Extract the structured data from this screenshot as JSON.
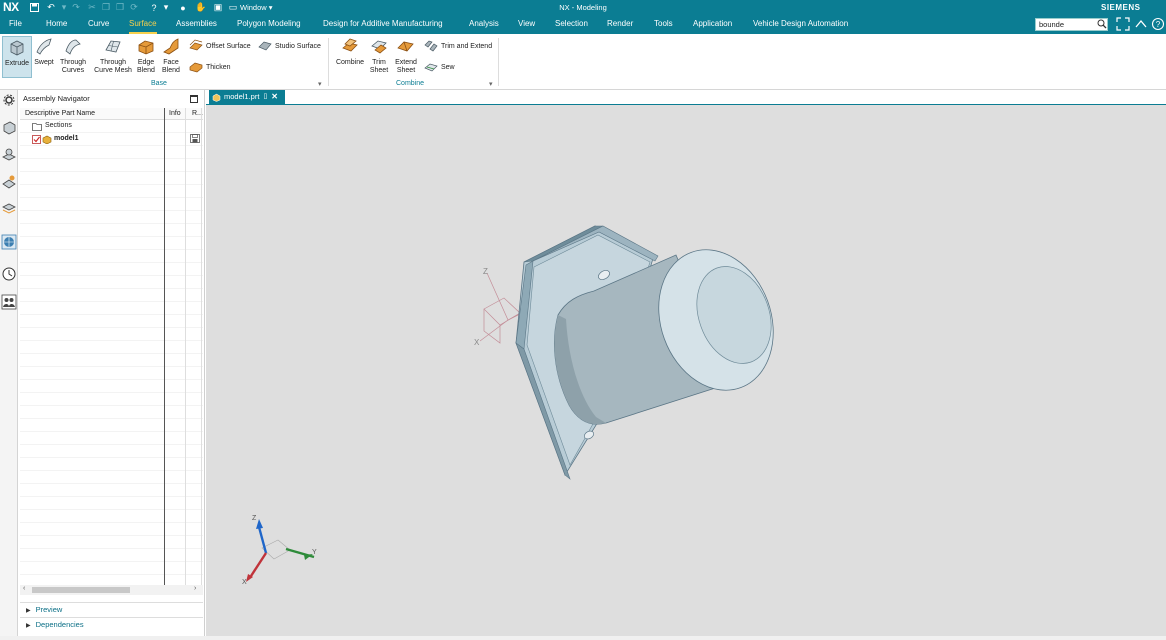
{
  "app": {
    "logo": "NX",
    "title": "NX - Modeling",
    "brand": "SIEMENS",
    "window_menu": "Window ▾"
  },
  "menu": {
    "tabs": [
      "File",
      "Home",
      "Curve",
      "Surface",
      "Assemblies",
      "Polygon Modeling",
      "Design for Additive Manufacturing",
      "Analysis",
      "View",
      "Selection",
      "Render",
      "Tools",
      "Application",
      "Vehicle Design Automation"
    ],
    "active_tab": "Surface",
    "search_value": "bounde"
  },
  "ribbon": {
    "base_group": {
      "label": "Base",
      "buttons": [
        {
          "label": "Extrude",
          "icon": "extrude-icon"
        },
        {
          "label": "Swept",
          "icon": "swept-icon"
        },
        {
          "label": "Through Curves",
          "icon": "through-curves-icon"
        },
        {
          "label": "Through Curve Mesh",
          "icon": "through-curve-mesh-icon"
        },
        {
          "label": "Edge Blend",
          "icon": "edge-blend-icon"
        },
        {
          "label": "Face Blend",
          "icon": "face-blend-icon"
        }
      ],
      "small_buttons": [
        {
          "label": "Offset Surface",
          "icon": "offset-surface-icon"
        },
        {
          "label": "Studio Surface",
          "icon": "studio-surface-icon"
        },
        {
          "label": "Thicken",
          "icon": "thicken-icon"
        }
      ]
    },
    "combine_group": {
      "label": "Combine",
      "buttons": [
        {
          "label": "Combine",
          "icon": "combine-icon"
        },
        {
          "label": "Trim Sheet",
          "icon": "trim-sheet-icon"
        },
        {
          "label": "Extend Sheet",
          "icon": "extend-sheet-icon"
        }
      ],
      "small_buttons": [
        {
          "label": "Trim and Extend",
          "icon": "trim-and-extend-icon"
        },
        {
          "label": "Sew",
          "icon": "sew-icon"
        }
      ]
    }
  },
  "navigator": {
    "title": "Assembly Navigator",
    "columns": [
      "Descriptive Part Name",
      "Info",
      "R..."
    ],
    "rows": [
      {
        "name": "Sections"
      },
      {
        "name": "model1"
      }
    ],
    "sections": [
      "Preview",
      "Dependencies"
    ]
  },
  "document": {
    "tab_label": "model1.prt"
  },
  "viewport": {
    "triad_labels": {
      "x": "X",
      "y": "Y",
      "z": "Z"
    },
    "colors": {
      "background": "#dedede",
      "model": "#8eaab6",
      "model_dark": "#5e7b88",
      "triad_x": "#c0333a",
      "triad_y": "#2e8b3a",
      "triad_z": "#1f66c9"
    }
  }
}
